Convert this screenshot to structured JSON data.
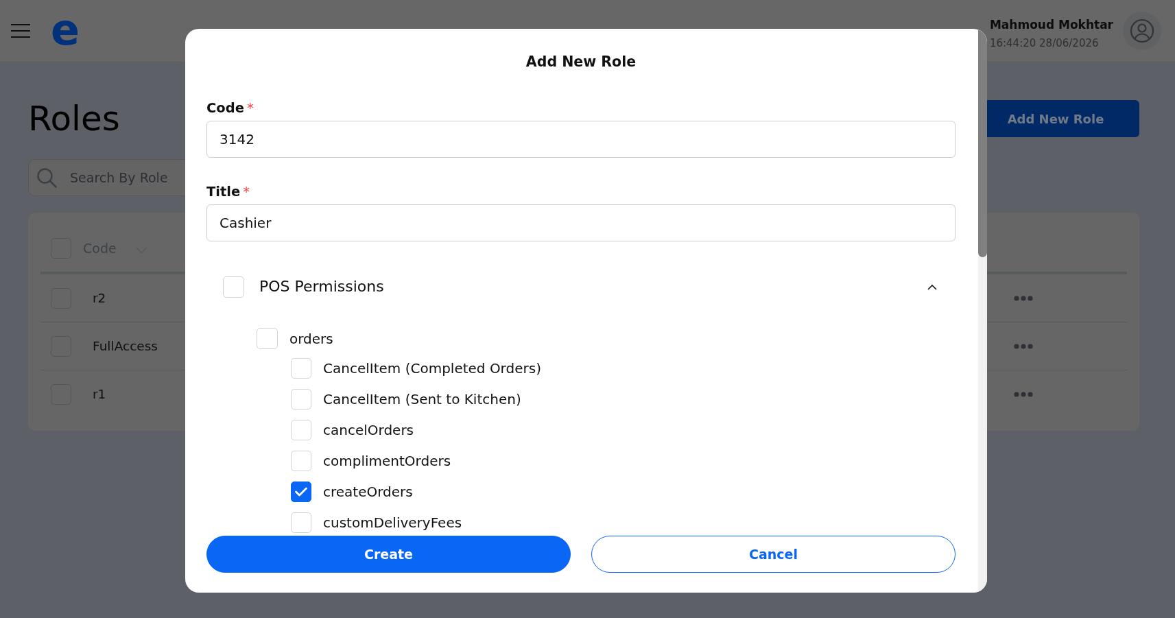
{
  "header": {
    "logo": "e",
    "user": {
      "name": "Mahmoud Mokhtar",
      "datetime": "16:44:20 28/06/2026"
    }
  },
  "page": {
    "title": "Roles",
    "search": {
      "placeholder": "Search By Role"
    },
    "add_button": "Add New Role"
  },
  "table": {
    "header_checked": false,
    "columns": [
      {
        "label": "Code"
      }
    ],
    "rows": [
      {
        "checked": false,
        "code": "r2"
      },
      {
        "checked": false,
        "code": "FullAccess"
      },
      {
        "checked": false,
        "code": "r1"
      }
    ]
  },
  "dialog": {
    "title": "Add New Role",
    "fields": [
      {
        "label": "Code",
        "required_mark": "*",
        "value": "3142"
      },
      {
        "label": "Title",
        "required_mark": "*",
        "value": "Cashier"
      }
    ],
    "permissions": [
      {
        "label": "POS Permissions",
        "checked": false,
        "expanded": true,
        "children": [
          {
            "label": "orders",
            "checked": false,
            "children": [
              {
                "label": "CancelItem (Completed Orders)",
                "checked": false
              },
              {
                "label": "CancelItem (Sent to Kitchen)",
                "checked": false
              },
              {
                "label": "cancelOrders",
                "checked": false
              },
              {
                "label": "complimentOrders",
                "checked": false
              },
              {
                "label": "createOrders",
                "checked": true
              },
              {
                "label": "customDeliveryFees",
                "checked": false
              }
            ]
          }
        ]
      }
    ],
    "buttons": [
      {
        "label": "Create",
        "kind": "primary"
      },
      {
        "label": "Cancel",
        "kind": "outline"
      }
    ]
  }
}
